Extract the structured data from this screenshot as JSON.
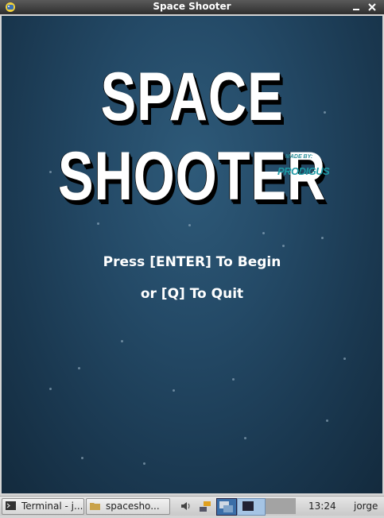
{
  "window": {
    "title": "Space Shooter"
  },
  "game": {
    "logo": "SPACE SHOOTER",
    "made_by": "MADE BY:",
    "author": "PRODIGUS",
    "prompt_line1": "Press [ENTER] To Begin",
    "prompt_line2": "or [Q] To Quit"
  },
  "taskbar": {
    "tasks": [
      {
        "label": "Terminal - j...",
        "icon": "terminal-icon"
      },
      {
        "label": "spacesho...",
        "icon": "folder-icon"
      }
    ],
    "tray_icons": [
      "volume-icon",
      "network-icon",
      "workspace-switcher-icon"
    ],
    "clock": "13:24",
    "user": "jorge"
  }
}
